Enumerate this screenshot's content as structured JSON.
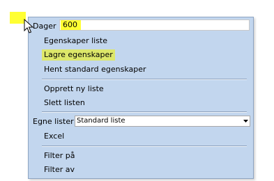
{
  "dager": {
    "label": "Dager",
    "value": "600"
  },
  "menu": {
    "items_group1": [
      "Egenskaper liste",
      "Lagre egenskaper",
      "Hent standard egenskaper"
    ],
    "items_group2": [
      "Opprett ny liste",
      "Slett listen"
    ],
    "egne_lister": {
      "label": "Egne lister",
      "selected": "Standard liste"
    },
    "items_group3": [
      "Excel"
    ],
    "items_group4": [
      "Filter på",
      "Filter av"
    ]
  },
  "colors": {
    "highlight": "#dde76a",
    "marker": "#ffff33",
    "menu_bg": "#c2d6ee"
  }
}
